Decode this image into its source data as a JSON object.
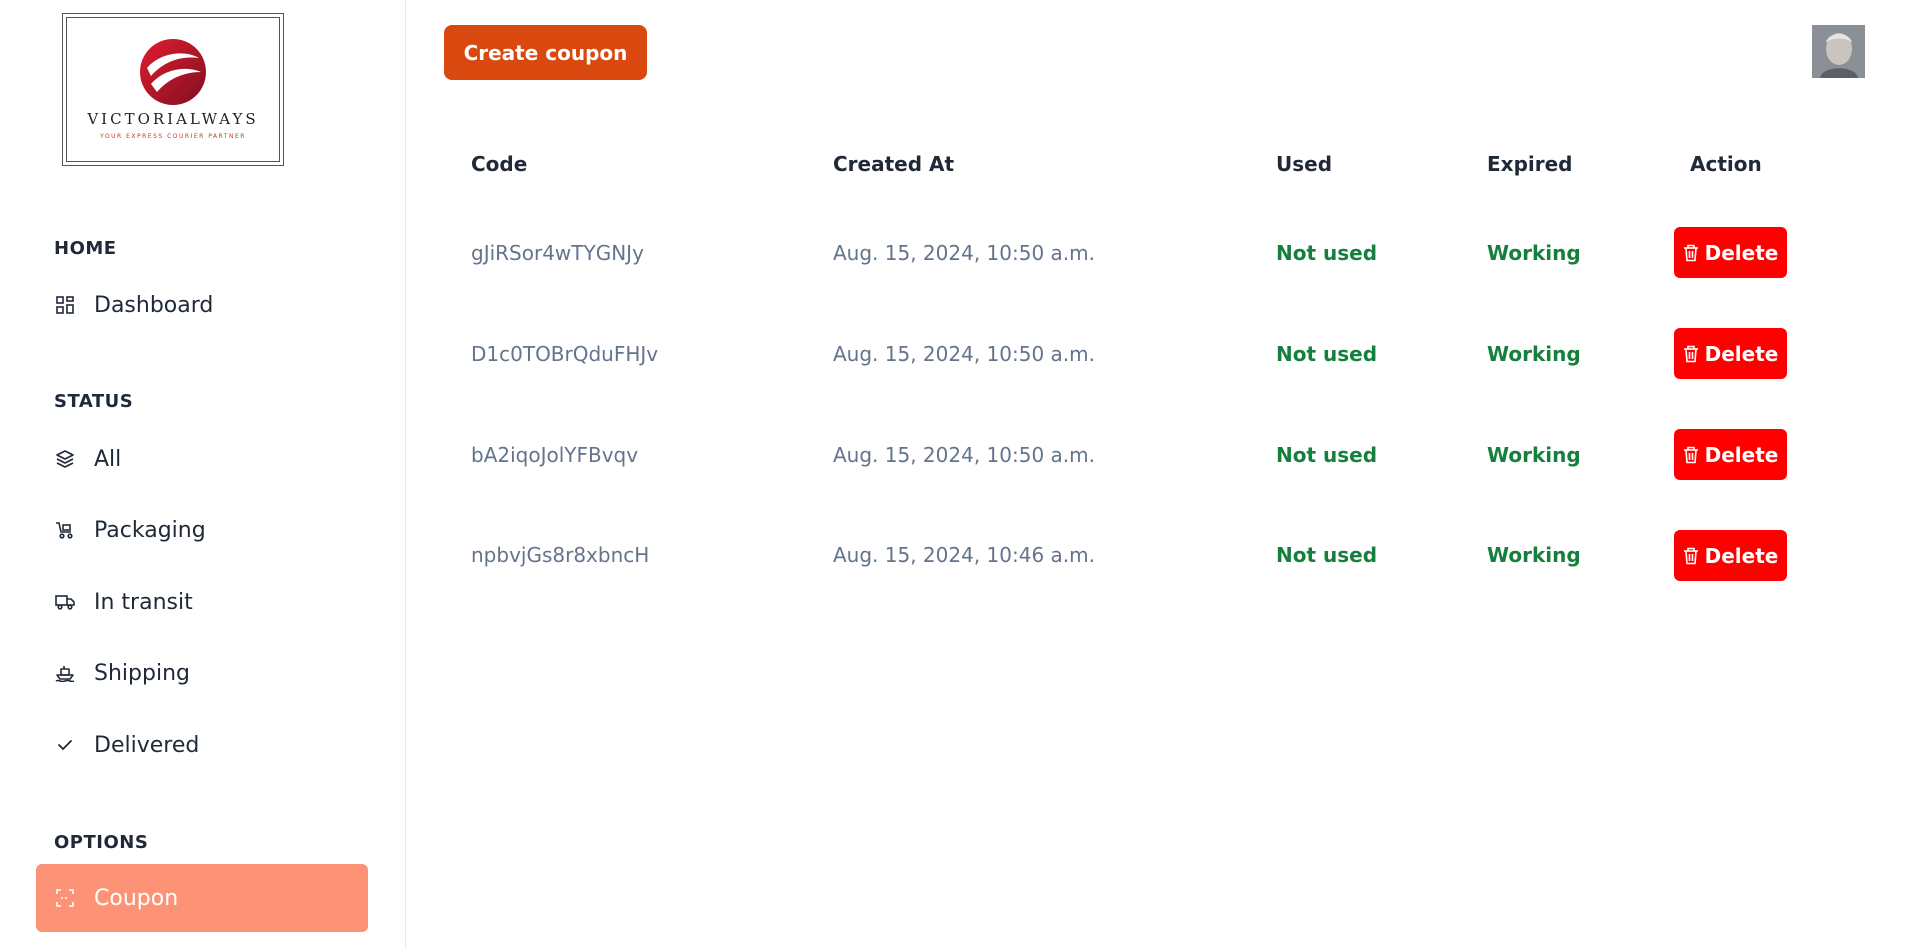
{
  "sidebar": {
    "logo": {
      "name": "VICTORIALWAYS",
      "tagline": "YOUR EXPRESS COURIER PARTNER"
    },
    "sections": {
      "home": {
        "heading": "HOME",
        "items": [
          {
            "label": "Dashboard",
            "icon": "dashboard-icon"
          }
        ]
      },
      "status": {
        "heading": "STATUS",
        "items": [
          {
            "label": "All",
            "icon": "layers-icon"
          },
          {
            "label": "Packaging",
            "icon": "cart-icon"
          },
          {
            "label": "In transit",
            "icon": "truck-icon"
          },
          {
            "label": "Shipping",
            "icon": "ship-icon"
          },
          {
            "label": "Delivered",
            "icon": "check-icon"
          }
        ]
      },
      "options": {
        "heading": "OPTIONS",
        "items": [
          {
            "label": "Coupon",
            "icon": "coupon-icon",
            "active": true
          }
        ]
      }
    }
  },
  "header": {
    "create_label": "Create coupon"
  },
  "table": {
    "headers": {
      "code": "Code",
      "created": "Created At",
      "used": "Used",
      "expired": "Expired",
      "action": "Action"
    },
    "rows": [
      {
        "code": "gJiRSor4wTYGNJy",
        "created": "Aug. 15, 2024, 10:50 a.m.",
        "used": "Not used",
        "expired": "Working",
        "action": "Delete"
      },
      {
        "code": "D1c0TOBrQduFHJv",
        "created": "Aug. 15, 2024, 10:50 a.m.",
        "used": "Not used",
        "expired": "Working",
        "action": "Delete"
      },
      {
        "code": "bA2iqoJolYFBvqv",
        "created": "Aug. 15, 2024, 10:50 a.m.",
        "used": "Not used",
        "expired": "Working",
        "action": "Delete"
      },
      {
        "code": "npbvjGs8r8xbncH",
        "created": "Aug. 15, 2024, 10:46 a.m.",
        "used": "Not used",
        "expired": "Working",
        "action": "Delete"
      }
    ]
  },
  "colors": {
    "accent": "#d9480f",
    "active_nav": "#fd9376",
    "delete": "#ff0000",
    "status_ok": "#15803d"
  }
}
